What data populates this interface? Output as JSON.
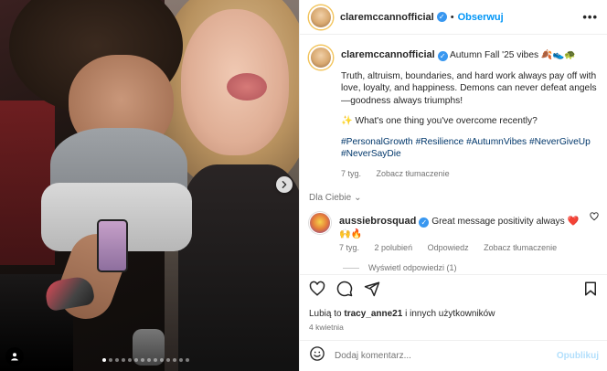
{
  "header": {
    "username": "claremccannofficial",
    "separator": "•",
    "follow_label": "Obserwuj",
    "more_label": "•••"
  },
  "caption": {
    "username": "claremccannofficial",
    "title_text": "Autumn Fall '25 vibes 🍂👟🐢",
    "paragraph1": "Truth, altruism, boundaries, and hard work always pay off with love, loyalty, and happiness. Demons can never defeat angels—goodness always triumphs!",
    "question": "✨ What's one thing you've overcome recently?",
    "hashtags": [
      "#PersonalGrowth",
      "#Resilience",
      "#AutumnVibes",
      "#NeverGiveUp",
      "#NeverSayDie"
    ],
    "time": "7 tyg.",
    "translate": "Zobacz tłumaczenie"
  },
  "comments_section": {
    "label": "Dla Ciebie",
    "chevron": "⌄"
  },
  "comments": [
    {
      "username": "aussiebrosquad",
      "text": "Great message positivity always ❤️🙌🔥",
      "time": "7 tyg.",
      "likes": "2 polubień",
      "reply": "Odpowiedz",
      "translate": "Zobacz tłumaczenie",
      "view_replies": "Wyświetl odpowiedzi (1)"
    }
  ],
  "likes_line": {
    "prefix": "Lubią to",
    "user": "tracy_anne21",
    "suffix": "i innych użytkowników"
  },
  "post_date": "4 kwietnia",
  "comment_input": {
    "placeholder": "Dodaj komentarz...",
    "post_label": "Opublikuj"
  },
  "carousel": {
    "dot_count": 14,
    "active_index": 0
  },
  "colors": {
    "accent": "#0095f6",
    "verified": "#3897f0",
    "hashtag": "#00376b",
    "muted": "#737373"
  }
}
